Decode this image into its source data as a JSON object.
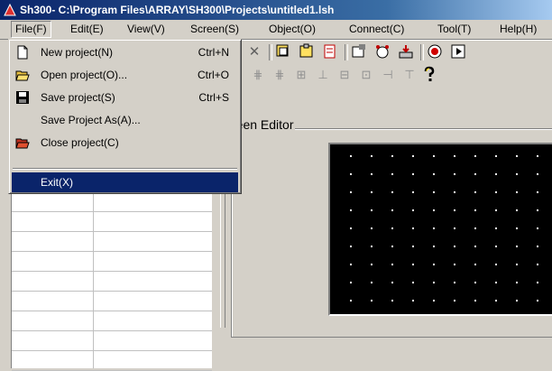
{
  "window": {
    "title": "Sh300- C:\\Program Files\\ARRAY\\SH300\\Projects\\untitled1.lsh"
  },
  "menubar": {
    "items": [
      {
        "label": "File(F)"
      },
      {
        "label": "Edit(E)"
      },
      {
        "label": "View(V)"
      },
      {
        "label": "Screen(S)"
      },
      {
        "label": "Object(O)"
      },
      {
        "label": "Connect(C)"
      },
      {
        "label": "Tool(T)"
      },
      {
        "label": "Help(H)"
      }
    ]
  },
  "file_menu": {
    "items": [
      {
        "label": "New project(N)",
        "shortcut": "Ctrl+N",
        "icon": "new-file-icon"
      },
      {
        "label": "Open project(O)...",
        "shortcut": "Ctrl+O",
        "icon": "open-folder-icon"
      },
      {
        "label": "Save project(S)",
        "shortcut": "Ctrl+S",
        "icon": "save-disk-icon"
      },
      {
        "label": "Save Project As(A)...",
        "shortcut": "",
        "icon": ""
      },
      {
        "label": "Close project(C)",
        "shortcut": "",
        "icon": "close-folder-icon"
      },
      {
        "label": "Exit(X)",
        "shortcut": "",
        "icon": ""
      }
    ],
    "highlighted": "Exit(X)"
  },
  "editor": {
    "group_label": "creen Editor"
  },
  "colors": {
    "title_start": "#0a246a",
    "title_end": "#a6caf0",
    "highlight": "#0a246a",
    "face": "#d4d0c8",
    "canvas": "#000000"
  }
}
